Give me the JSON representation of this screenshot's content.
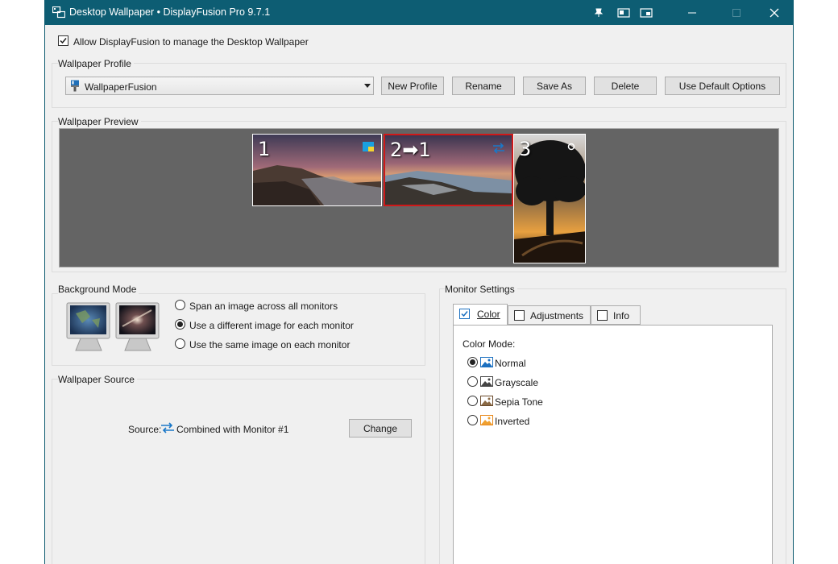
{
  "window": {
    "title": "Desktop Wallpaper • DisplayFusion Pro 9.7.1",
    "accent": "#0d5d73"
  },
  "allow_manage": {
    "label": "Allow DisplayFusion to manage the Desktop Wallpaper",
    "checked": true
  },
  "profile": {
    "group_title": "Wallpaper Profile",
    "selected": "WallpaperFusion",
    "buttons": {
      "new": "New Profile",
      "rename": "Rename",
      "save_as": "Save As",
      "delete": "Delete",
      "default": "Use Default Options"
    }
  },
  "preview": {
    "group_title": "Wallpaper Preview",
    "monitors": [
      {
        "label": "1",
        "selected": false
      },
      {
        "label": "2➡1",
        "selected": true
      },
      {
        "label": "3",
        "selected": false
      }
    ]
  },
  "background_mode": {
    "group_title": "Background Mode",
    "options": [
      {
        "label": "Span an image across all monitors",
        "selected": false
      },
      {
        "label": "Use a different image for each monitor",
        "selected": true
      },
      {
        "label": "Use the same image on each monitor",
        "selected": false
      }
    ]
  },
  "source": {
    "group_title": "Wallpaper Source",
    "label": "Source:",
    "value": "Combined with Monitor #1",
    "change_button": "Change"
  },
  "monitor_settings": {
    "group_title": "Monitor Settings",
    "tabs": [
      {
        "label": "Color",
        "active": true
      },
      {
        "label": "Adjustments",
        "active": false
      },
      {
        "label": "Info",
        "active": false
      }
    ],
    "color_mode_label": "Color Mode:",
    "color_modes": [
      {
        "label": "Normal",
        "selected": true,
        "icon": "image-icon-blue"
      },
      {
        "label": "Grayscale",
        "selected": false,
        "icon": "image-icon-gray"
      },
      {
        "label": "Sepia Tone",
        "selected": false,
        "icon": "image-icon-sepia"
      },
      {
        "label": "Inverted",
        "selected": false,
        "icon": "image-icon-orange"
      }
    ]
  }
}
